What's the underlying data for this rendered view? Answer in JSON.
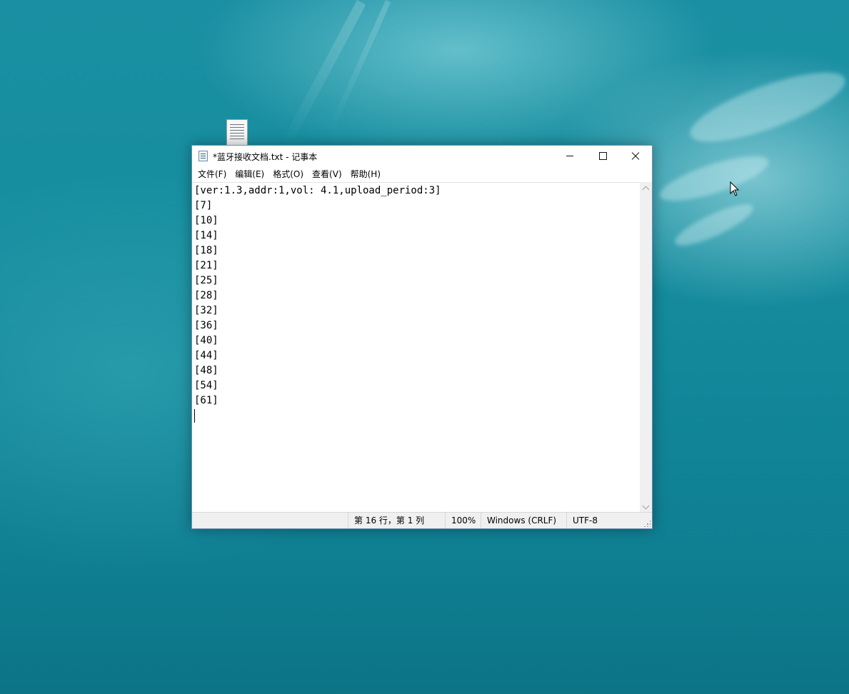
{
  "window": {
    "title": "*蓝牙接收文档.txt - 记事本"
  },
  "menu": [
    {
      "label": "文件(F)"
    },
    {
      "label": "编辑(E)"
    },
    {
      "label": "格式(O)"
    },
    {
      "label": "查看(V)"
    },
    {
      "label": "帮助(H)"
    }
  ],
  "editor": {
    "lines": [
      "[ver:1.3,addr:1,vol: 4.1,upload_period:3]",
      "[7]",
      "[10]",
      "[14]",
      "[18]",
      "[21]",
      "[25]",
      "[28]",
      "[32]",
      "[36]",
      "[40]",
      "[44]",
      "[48]",
      "[54]",
      "[61]"
    ]
  },
  "status": {
    "position": "第 16 行，第 1 列",
    "zoom": "100%",
    "line_ending": "Windows (CRLF)",
    "encoding": "UTF-8"
  },
  "icons": {
    "desktop_file": "text-document-icon",
    "app": "notepad-icon",
    "minimize": "minimize-icon",
    "maximize": "maximize-icon",
    "close": "close-icon",
    "cursor": "mouse-pointer-icon"
  }
}
